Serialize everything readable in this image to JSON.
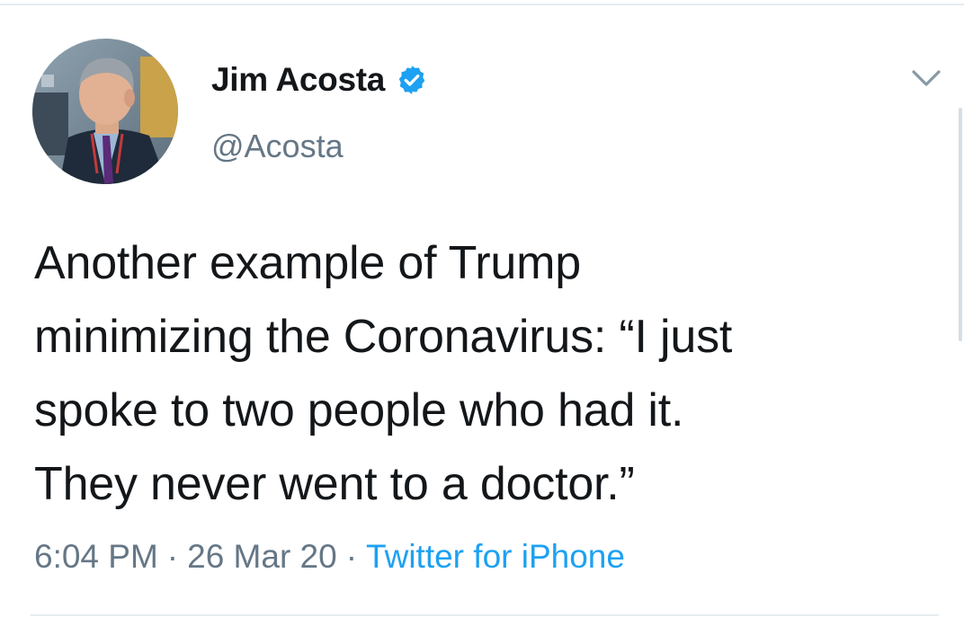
{
  "author": {
    "display_name": "Jim Acosta",
    "handle": "@Acosta",
    "verified": true,
    "avatar_icon": "profile-photo"
  },
  "tweet": {
    "lines": [
      "Another example of Trump",
      "minimizing the Coronavirus: “I just",
      "spoke to two people who had it.",
      "They never went to a doctor.”"
    ]
  },
  "meta": {
    "time": "6:04 PM",
    "date": "26 Mar 20",
    "separator": "·",
    "source": "Twitter for iPhone"
  },
  "icons": {
    "verified": "verified-badge-icon",
    "menu": "chevron-down-icon"
  },
  "colors": {
    "text": "#14171a",
    "secondary": "#657786",
    "link": "#1da1f2",
    "verified": "#1da1f2",
    "divider": "#e6ecf0"
  }
}
